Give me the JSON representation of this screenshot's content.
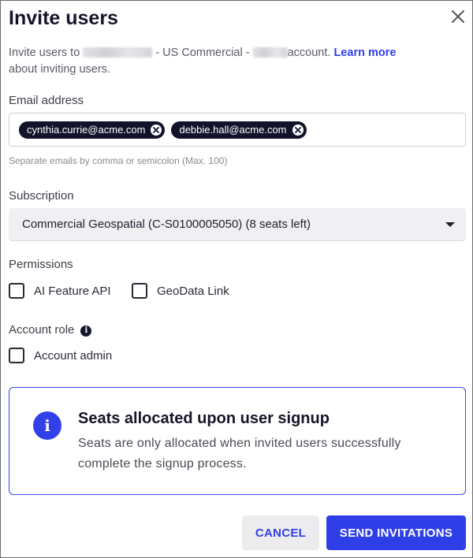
{
  "dialog": {
    "title": "Invite users",
    "intro": {
      "prefix": "Invite users to",
      "middle": "- US Commercial -",
      "suffix": "account.",
      "learn_more": "Learn more",
      "tail": "about inviting users."
    }
  },
  "email": {
    "label": "Email address",
    "chips": [
      "cynthia.currie@acme.com",
      "debbie.hall@acme.com"
    ],
    "hint": "Separate emails by comma or semicolon (Max. 100)"
  },
  "subscription": {
    "label": "Subscription",
    "selected": "Commercial Geospatial (C-S0100005050) (8 seats left)"
  },
  "permissions": {
    "label": "Permissions",
    "options": [
      {
        "label": "AI Feature API",
        "checked": false
      },
      {
        "label": "GeoData Link",
        "checked": false
      }
    ]
  },
  "account_role": {
    "label": "Account role",
    "option": {
      "label": "Account admin",
      "checked": false
    }
  },
  "notice": {
    "title": "Seats allocated upon user signup",
    "body": "Seats are only allocated when invited users successfully complete the signup process."
  },
  "actions": {
    "cancel": "CANCEL",
    "send": "SEND INVITATIONS"
  },
  "colors": {
    "accent": "#2f3fe8",
    "chip_bg": "#12122b",
    "title": "#15152a"
  }
}
